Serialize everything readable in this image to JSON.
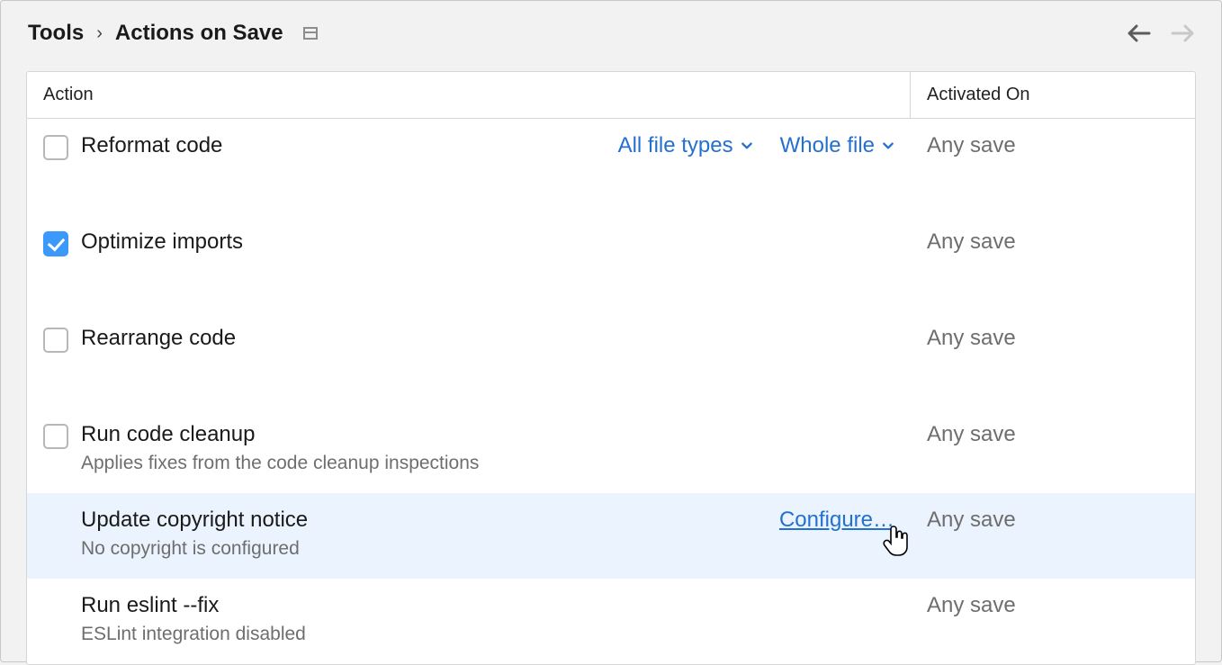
{
  "breadcrumb": {
    "root": "Tools",
    "current": "Actions on Save"
  },
  "columns": {
    "action": "Action",
    "activated": "Activated On"
  },
  "rows": {
    "reformat": {
      "title": "Reformat code",
      "activated": "Any save",
      "opt_file_types": "All file types",
      "opt_scope": "Whole file"
    },
    "optimize": {
      "title": "Optimize imports",
      "activated": "Any save"
    },
    "rearrange": {
      "title": "Rearrange code",
      "activated": "Any save"
    },
    "cleanup": {
      "title": "Run code cleanup",
      "desc": "Applies fixes from the code cleanup inspections",
      "activated": "Any save"
    },
    "copyright": {
      "title": "Update copyright notice",
      "desc": "No copyright is configured",
      "configure": "Configure…",
      "activated": "Any save"
    },
    "eslint": {
      "title": "Run eslint --fix",
      "desc": "ESLint integration disabled",
      "activated": "Any save"
    }
  }
}
